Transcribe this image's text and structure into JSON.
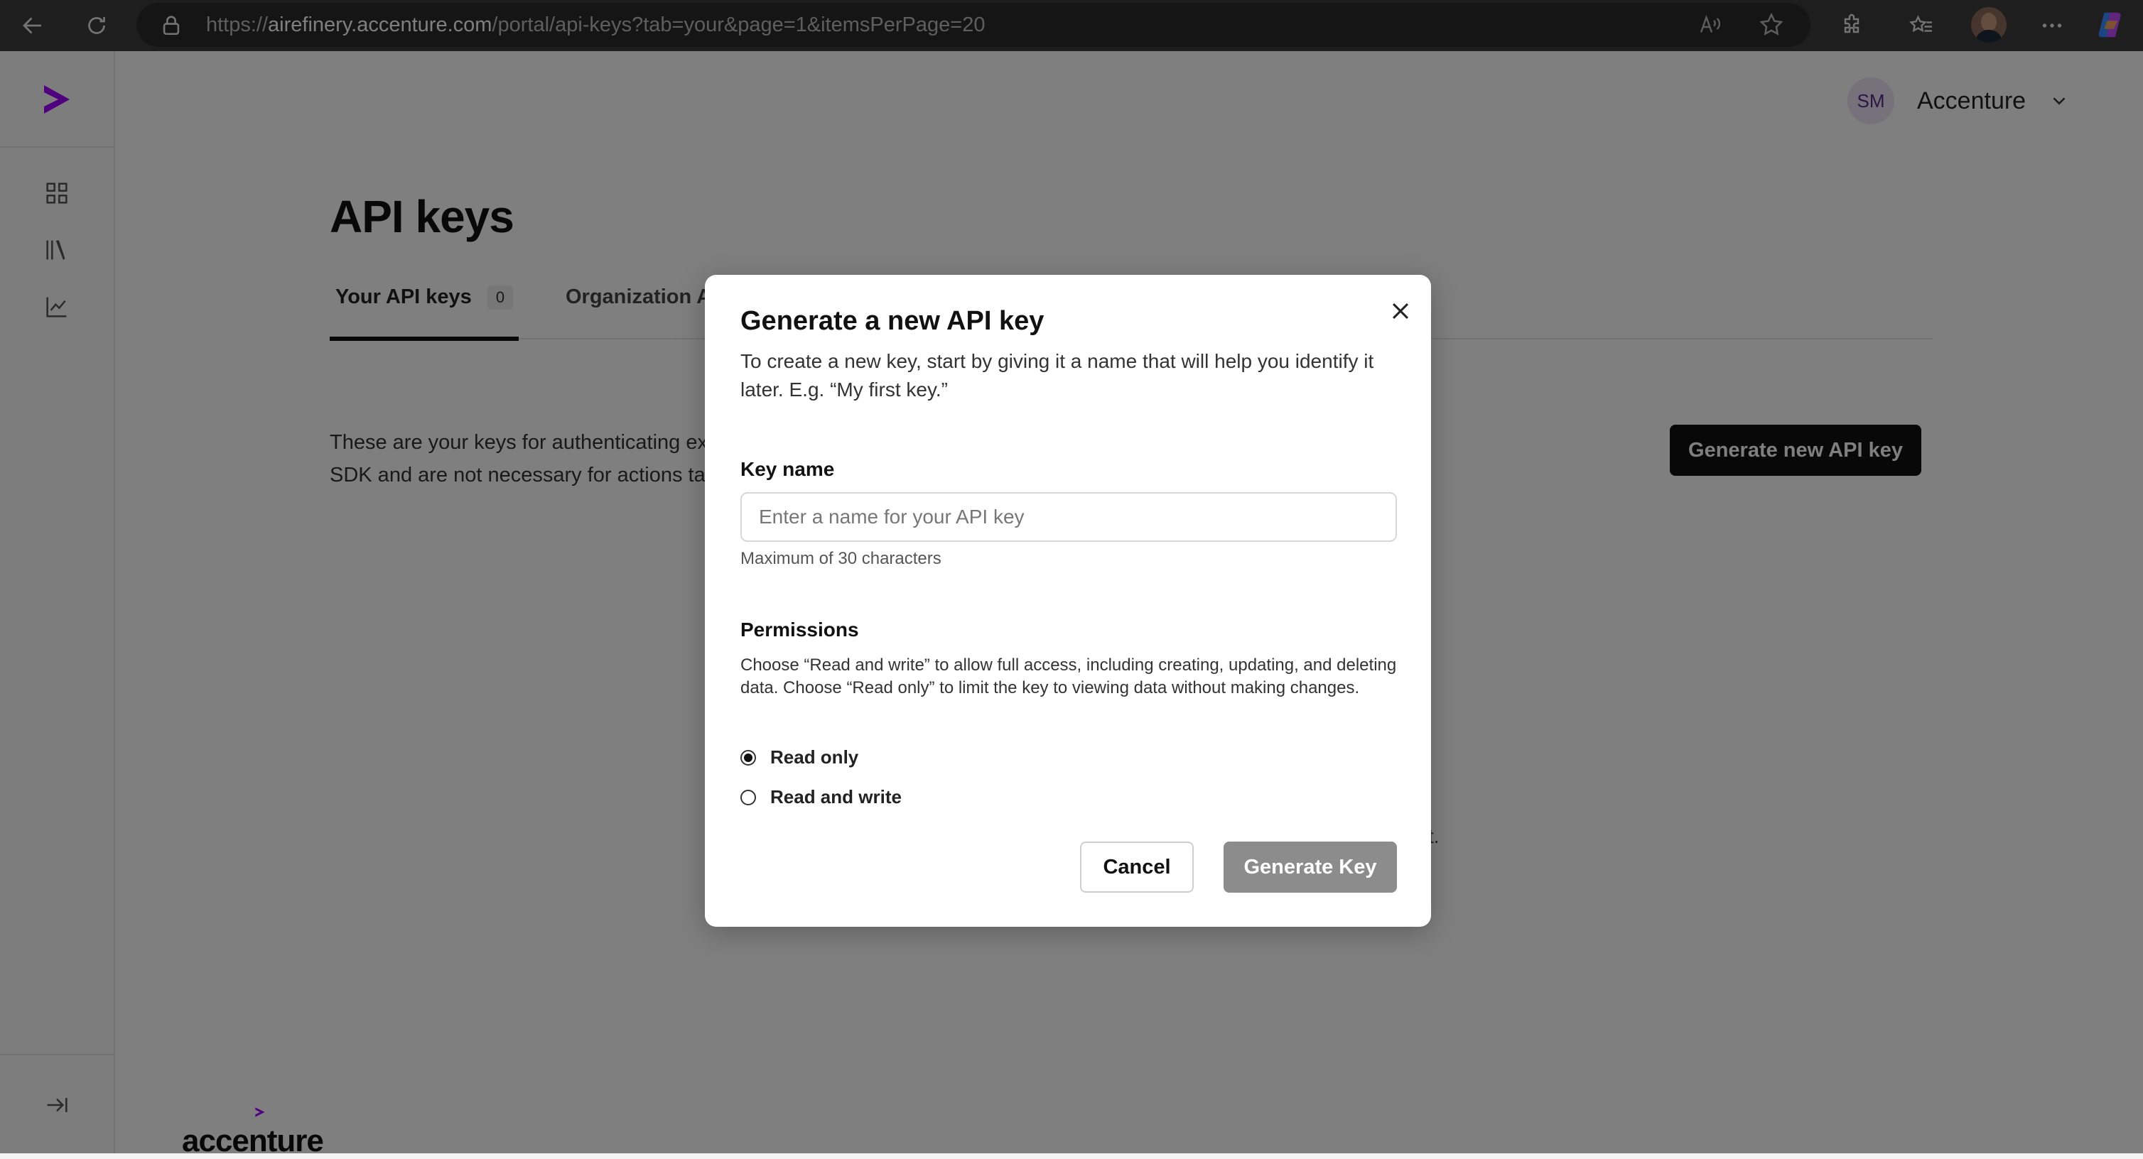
{
  "browser": {
    "url_prefix": "https://",
    "url_host": "airefinery.accenture.com",
    "url_path": "/portal/api-keys?tab=your&page=1&itemsPerPage=20"
  },
  "header": {
    "user_initials": "SM",
    "org_name": "Accenture"
  },
  "page": {
    "title": "API keys",
    "tabs": [
      {
        "label": "Your API keys",
        "count": "0"
      },
      {
        "label": "Organization A"
      }
    ],
    "intro": "These are your keys for authenticating e… SDK and are not necessary for actions ta…",
    "intro_line1": "These are your keys for authenticating ex",
    "intro_line2": "SDK and are not necessary for actions ta",
    "generate_button": "Generate new API key",
    "empty_tail": "t.",
    "footer_brand": "accenture"
  },
  "modal": {
    "title": "Generate a new API key",
    "description": "To create a new key, start by giving it a name that will help you identify it later. E.g. “My first key.”",
    "key_name_label": "Key name",
    "key_name_placeholder": "Enter a name for your API key",
    "key_name_hint": "Maximum of 30 characters",
    "permissions_label": "Permissions",
    "permissions_description": "Choose “Read and write” to allow full access, including creating, updating, and deleting data. Choose “Read only” to limit the key to viewing data without making changes.",
    "options": [
      {
        "label": "Read only",
        "selected": true
      },
      {
        "label": "Read and write",
        "selected": false
      }
    ],
    "cancel_label": "Cancel",
    "generate_label": "Generate Key"
  },
  "colors": {
    "brand_purple": "#a100ff",
    "overlay": "#000000",
    "disabled_button": "#8c8c8c"
  },
  "icons": [
    "back-icon",
    "refresh-icon",
    "lock-icon",
    "read-aloud-icon",
    "star-icon",
    "extensions-icon",
    "favorites-icon",
    "more-icon",
    "copilot-icon",
    "accenture-logo",
    "grid-icon",
    "library-icon",
    "chart-icon",
    "expand-icon",
    "chevron-down-icon",
    "close-icon"
  ]
}
